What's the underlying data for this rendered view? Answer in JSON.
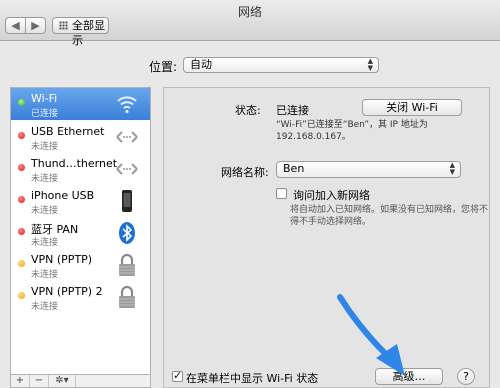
{
  "window": {
    "title": "网络"
  },
  "toolbar": {
    "back": "◀",
    "forward": "▶",
    "show_all": "全部显示"
  },
  "location": {
    "label": "位置:",
    "value": "自动"
  },
  "services": [
    {
      "name": "Wi-Fi",
      "status": "已连接",
      "dot": "green",
      "icon": "wifi-icon",
      "selected": true
    },
    {
      "name": "USB Ethernet",
      "status": "未连接",
      "dot": "red",
      "icon": "ethernet-icon"
    },
    {
      "name": "Thund…thernet",
      "status": "未连接",
      "dot": "red",
      "icon": "ethernet-icon"
    },
    {
      "name": "iPhone USB",
      "status": "未连接",
      "dot": "red",
      "icon": "iphone-icon"
    },
    {
      "name": "蓝牙 PAN",
      "status": "未连接",
      "dot": "red",
      "icon": "bluetooth-icon"
    },
    {
      "name": "VPN (PPTP)",
      "status": "未连接",
      "dot": "yellow",
      "icon": "lock-icon"
    },
    {
      "name": "VPN (PPTP) 2",
      "status": "未连接",
      "dot": "yellow",
      "icon": "lock-icon"
    }
  ],
  "sidebar_footer": {
    "add": "+",
    "remove": "−",
    "gear": "✲▾"
  },
  "detail": {
    "status_label": "状态:",
    "status_value": "已连接",
    "toggle_button": "关闭 Wi-Fi",
    "status_desc_1": "“Wi-Fi”已连接至“Ben”，其 IP 地址为",
    "status_desc_2": "192.168.0.167。",
    "network_name_label": "网络名称:",
    "network_name_value": "Ben",
    "ask_join_label": "询问加入新网络",
    "ask_join_desc_1": "将自动加入已知网络。如果没有已知网络，您将不",
    "ask_join_desc_2": "得不手动选择网络。",
    "menubar_label": "在菜单栏中显示 Wi-Fi 状态",
    "advanced_button": "高级…",
    "help_button": "?"
  },
  "colors": {
    "selection": "#3a7fd8",
    "arrow": "#2f86e6"
  }
}
